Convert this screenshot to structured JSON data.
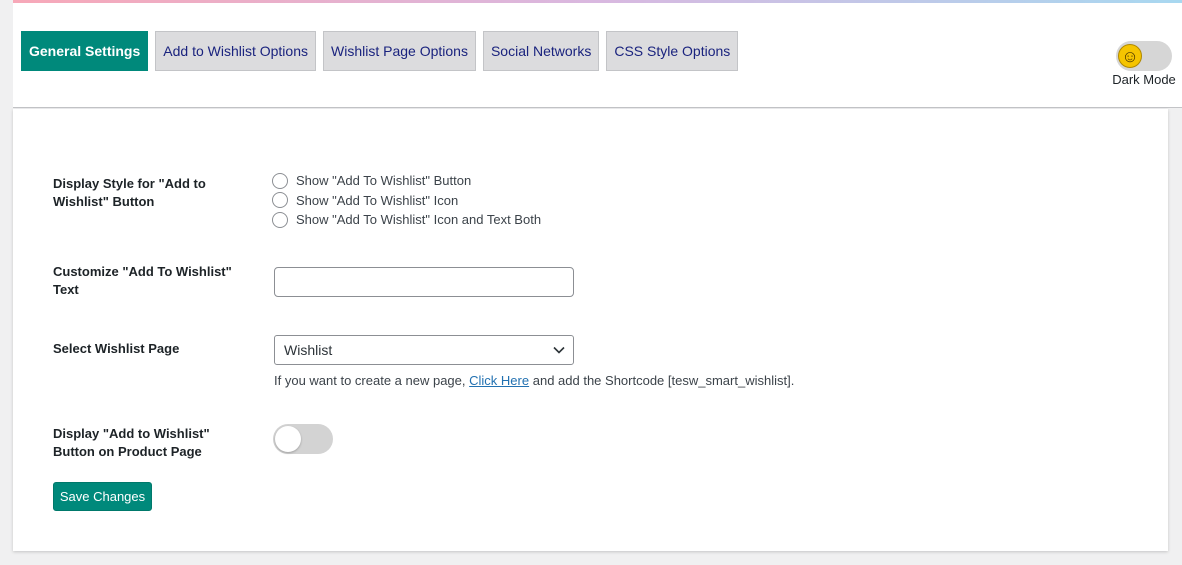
{
  "tabs": [
    {
      "label": "General Settings",
      "active": true
    },
    {
      "label": "Add to Wishlist Options",
      "active": false
    },
    {
      "label": "Wishlist Page Options",
      "active": false
    },
    {
      "label": "Social Networks",
      "active": false
    },
    {
      "label": "CSS Style Options",
      "active": false
    }
  ],
  "dark_mode": {
    "label": "Dark Mode",
    "icon": "smiley-icon",
    "enabled": false
  },
  "settings": {
    "display_style": {
      "label": "Display Style for \"Add to Wishlist\" Button",
      "options": [
        "Show \"Add To Wishlist\" Button",
        "Show \"Add To Wishlist\" Icon",
        "Show \"Add To Wishlist\" Icon and Text Both"
      ],
      "selected": null
    },
    "customize_text": {
      "label": "Customize \"Add To Wishlist\" Text",
      "value": "",
      "placeholder": ""
    },
    "wishlist_page": {
      "label": "Select Wishlist Page",
      "selected": "Wishlist",
      "help_prefix": "If you want to create a new page,",
      "help_link": "Click Here",
      "help_suffix": "and add the Shortcode [tesw_smart_wishlist]."
    },
    "product_page_button": {
      "label": "Display \"Add to Wishlist\" Button on Product Page",
      "enabled": false
    }
  },
  "save_label": "Save Changes",
  "colors": {
    "accent": "#00897b",
    "tab_text": "#1a237e",
    "link": "#2271b1"
  }
}
